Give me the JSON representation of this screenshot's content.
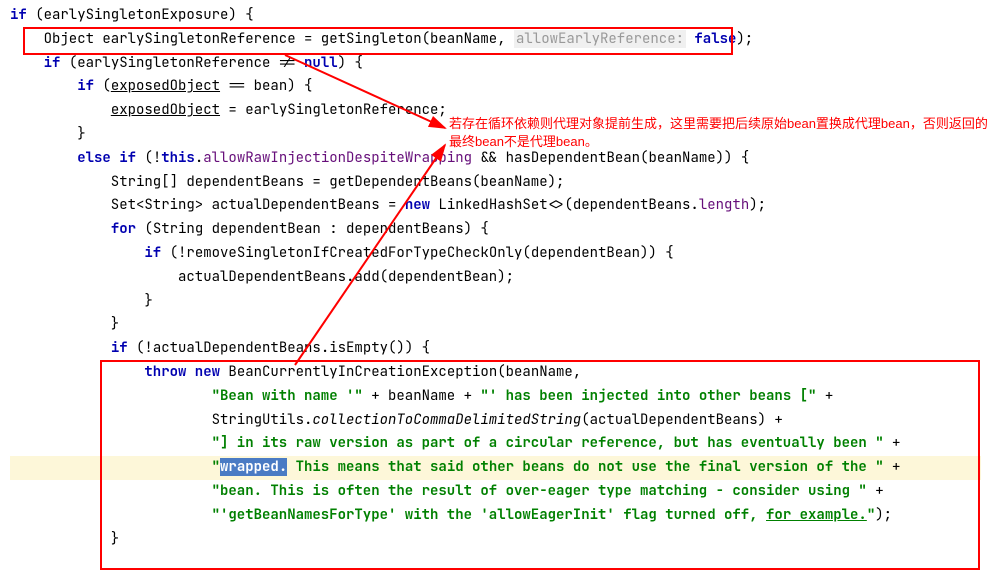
{
  "code": {
    "l1": "if",
    "l1b": " (earlySingletonExposure) {",
    "l2a": "    Object earlySingletonReference = getSingleton(beanName, ",
    "l2hint": "allowEarlyReference:",
    "l2b": " ",
    "l2false": "false",
    "l2c": ");",
    "l3a": "    ",
    "l3if": "if",
    "l3b": " (earlySingletonReference != ",
    "l3null": "null",
    "l3c": ") {",
    "l4a": "        ",
    "l4if": "if",
    "l4b": " (",
    "l4exp": "exposedObject",
    "l4c": " == bean) {",
    "l5a": "            ",
    "l5exp": "exposedObject",
    "l5b": " = earlySingletonReference;",
    "l6": "        }",
    "l7a": "        ",
    "l7else": "else if",
    "l7b": " (!",
    "l7this": "this",
    "l7c": ".",
    "l7field": "allowRawInjectionDespiteWrapping",
    "l7d": " && hasDependentBean(beanName)) {",
    "l8": "            String[] dependentBeans = getDependentBeans(beanName);",
    "l9a": "            Set<String> actualDependentBeans = ",
    "l9new": "new",
    "l9b": " LinkedHashSet<>(dependentBeans.",
    "l9len": "length",
    "l9c": ");",
    "l10a": "            ",
    "l10for": "for",
    "l10b": " (String dependentBean : dependentBeans) {",
    "l11a": "                ",
    "l11if": "if",
    "l11b": " (!removeSingletonIfCreatedForTypeCheckOnly(dependentBean)) {",
    "l12": "                    actualDependentBeans.add(dependentBean);",
    "l13": "                }",
    "l14": "            }",
    "l15a": "            ",
    "l15if": "if",
    "l15b": " (!actualDependentBeans.isEmpty()) {",
    "l16a": "                ",
    "l16throw": "throw new",
    "l16b": " BeanCurrentlyInCreationException(beanName,",
    "l17a": "                        ",
    "l17s": "\"Bean with name '\"",
    "l17b": " + beanName + ",
    "l17s2": "\"' has been injected into other beans [\"",
    "l17c": " +",
    "l18a": "                        StringUtils.",
    "l18m": "collectionToCommaDelimitedString",
    "l18b": "(actualDependentBeans) +",
    "l19a": "                        ",
    "l19s": "\"] in its raw version as part of a circular reference, but has eventually been \"",
    "l19b": " +",
    "l20a": "                        ",
    "l20s1": "\"",
    "l20sel": "wrapped.",
    "l20s2": " This means that said other beans do not use the final version of the \"",
    "l20b": " +",
    "l21a": "                        ",
    "l21s": "\"bean. This is often the result of over-eager type matching - consider using \"",
    "l21b": " +",
    "l22a": "                        ",
    "l22s": "\"'getBeanNamesForType' with the 'allowEagerInit' flag turned off, ",
    "l22s2": "for example.",
    "l22s3": "\"",
    "l22b": ");",
    "l23": "            }"
  },
  "annotation": {
    "text": "若存在循环依赖则代理对象提前生成，这里需要把后续原始bean置换成代理bean，否则返回的最终bean不是代理bean。"
  }
}
